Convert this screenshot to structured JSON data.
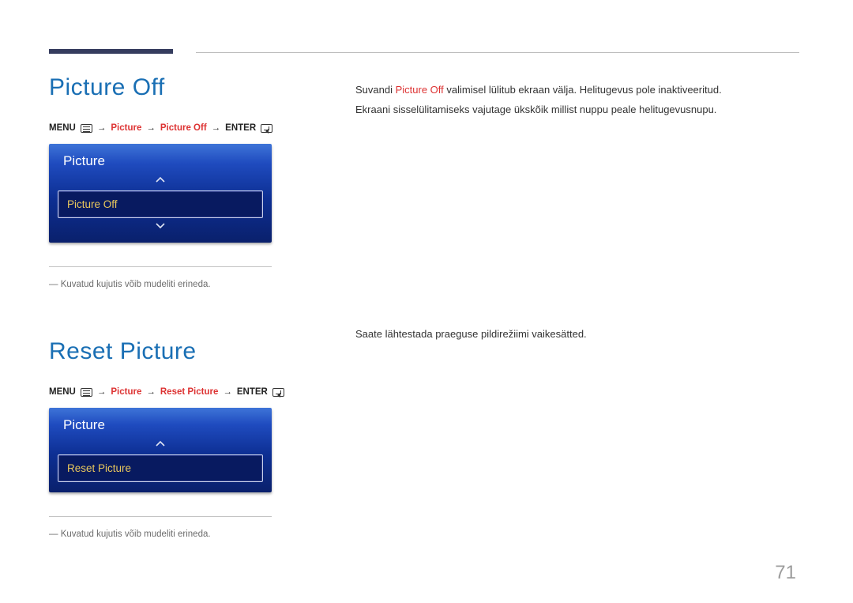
{
  "page_number": "71",
  "sections": {
    "a": {
      "title": "Picture Off",
      "path_menu": "MENU",
      "path_l1": "Picture",
      "path_l2": "Picture Off",
      "path_enter": "ENTER",
      "osd_title": "Picture",
      "osd_option": "Picture Off",
      "note": "―  Kuvatud kujutis võib mudeliti erineda.",
      "body": {
        "p1_prefix": "Suvandi ",
        "p1_highlight": "Picture Off",
        "p1_suffix": " valimisel lülitub ekraan välja. Helitugevus pole inaktiveeritud.",
        "p2": "Ekraani sisselülitamiseks vajutage ükskõik millist nuppu peale helitugevusnupu."
      }
    },
    "b": {
      "title": "Reset Picture",
      "path_menu": "MENU",
      "path_l1": "Picture",
      "path_l2": "Reset Picture",
      "path_enter": "ENTER",
      "osd_title": "Picture",
      "osd_option": "Reset Picture",
      "note": "―  Kuvatud kujutis võib mudeliti erineda.",
      "body": {
        "p1": "Saate lähtestada praeguse pildirežiimi vaikesätted."
      }
    }
  }
}
